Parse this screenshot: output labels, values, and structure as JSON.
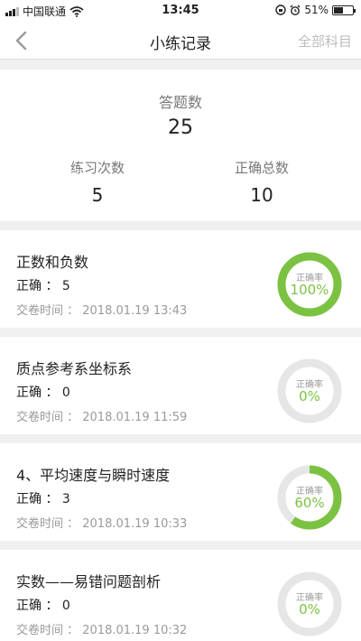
{
  "status_bar": {
    "carrier": "中国联通",
    "time": "13:45",
    "battery": "51%",
    "battery_level": 0.51
  },
  "nav": {
    "title": "小练记录",
    "right_action": "全部科目"
  },
  "summary": {
    "answered_label": "答题数",
    "answered_value": "25",
    "practice_label": "练习次数",
    "practice_value": "5",
    "correct_total_label": "正确总数",
    "correct_total_value": "10"
  },
  "colors": {
    "accent": "#7cc242",
    "track": "#e6e6e6"
  },
  "records": [
    {
      "title": "正数和负数",
      "correct": "正确 ： 5",
      "time": "交卷时间 ： 2018.01.19 13:43",
      "rate_label": "正确率",
      "rate_text": "100%",
      "rate": 1.0
    },
    {
      "title": "质点参考系坐标系",
      "correct": "正确 ： 0",
      "time": "交卷时间 ： 2018.01.19 11:59",
      "rate_label": "正确率",
      "rate_text": "0%",
      "rate": 0.0
    },
    {
      "title": "4、平均速度与瞬时速度",
      "correct": "正确 ： 3",
      "time": "交卷时间 ： 2018.01.19 10:33",
      "rate_label": "正确率",
      "rate_text": "60%",
      "rate": 0.6
    },
    {
      "title": "实数——易错问题剖析",
      "correct": "正确 ： 0",
      "time": "交卷时间 ： 2018.01.19 10:32",
      "rate_label": "正确率",
      "rate_text": "0%",
      "rate": 0.0
    }
  ]
}
